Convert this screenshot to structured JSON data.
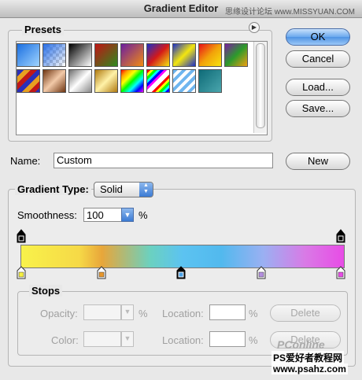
{
  "window": {
    "title": "Gradient Editor"
  },
  "watermarks": {
    "top": "思缘设计论坛 www.MISSYUAN.COM",
    "pconline": "PConline",
    "bottom_cn": "PS爱好者教程网",
    "bottom_url": "www.psahz.com"
  },
  "presets": {
    "label": "Presets",
    "flyout_icon": "arrow-right-circle-icon"
  },
  "buttons": {
    "ok": "OK",
    "cancel": "Cancel",
    "load": "Load...",
    "save": "Save...",
    "new": "New"
  },
  "name_row": {
    "label": "Name:",
    "value": "Custom"
  },
  "gradient_type": {
    "label": "Gradient Type:",
    "value": "Solid"
  },
  "smoothness": {
    "label": "Smoothness:",
    "value": "100",
    "unit": "%"
  },
  "stops": {
    "label": "Stops",
    "opacity_label": "Opacity:",
    "opacity_unit": "%",
    "location_label": "Location:",
    "location_unit": "%",
    "color_label": "Color:",
    "delete_label": "Delete"
  },
  "colors": {
    "stop_colors": [
      "#f6f041",
      "#e8972c",
      "#4ba2e8",
      "#b48fe0",
      "#e84ce6"
    ],
    "accent": "#4f93e3"
  }
}
